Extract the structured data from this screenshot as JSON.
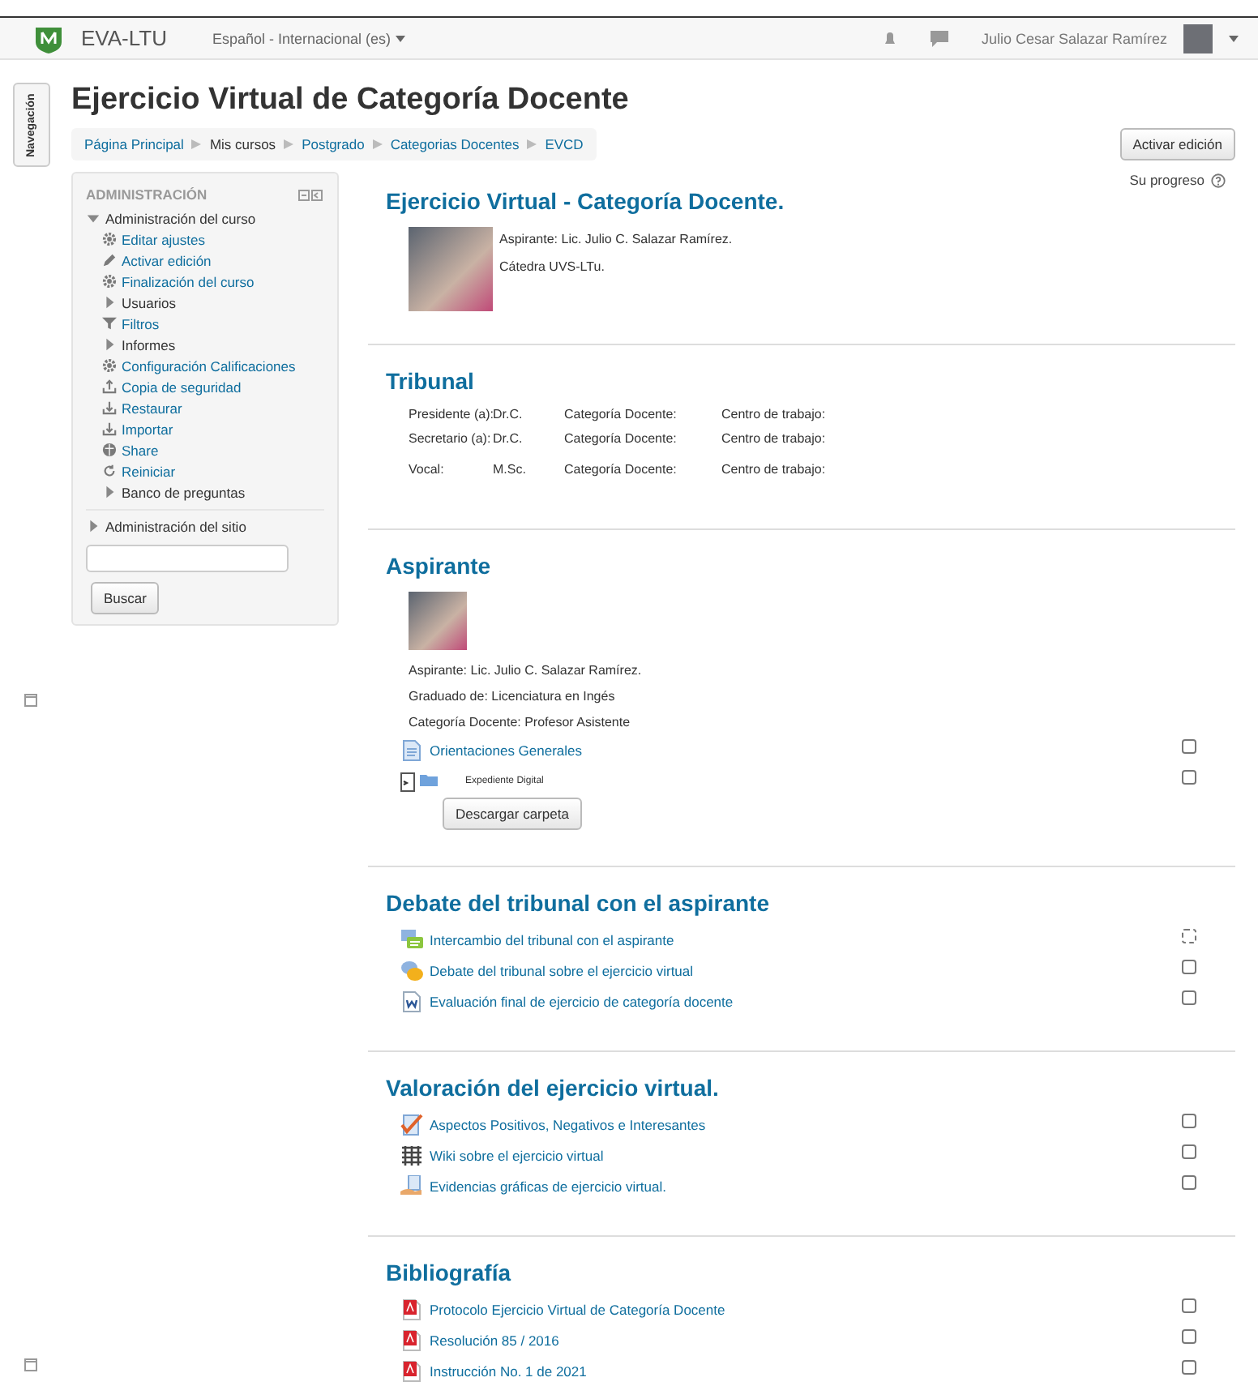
{
  "header": {
    "site_name": "EVA-LTU",
    "language": "Español - Internacional (es)",
    "user_name": "Julio Cesar Salazar Ramírez"
  },
  "nav_tab": "Navegación",
  "page_title": "Ejercicio Virtual de Categoría Docente",
  "breadcrumb": [
    {
      "label": "Página Principal",
      "link": true
    },
    {
      "label": "Mis cursos",
      "link": false
    },
    {
      "label": "Postgrado",
      "link": true
    },
    {
      "label": "Categorias Docentes",
      "link": true
    },
    {
      "label": "EVCD",
      "link": true
    }
  ],
  "edit_button": "Activar edición",
  "admin_block": {
    "title": "ADMINISTRACIÓN",
    "search_button": "Buscar",
    "items": [
      {
        "label": "Administración del curso",
        "kind": "branch",
        "expanded": true,
        "children": [
          {
            "label": "Editar ajustes",
            "kind": "gear"
          },
          {
            "label": "Activar edición",
            "kind": "pencil"
          },
          {
            "label": "Finalización del curso",
            "kind": "gear"
          },
          {
            "label": "Usuarios",
            "kind": "branch",
            "expanded": false
          },
          {
            "label": "Filtros",
            "kind": "filter"
          },
          {
            "label": "Informes",
            "kind": "branch",
            "expanded": false
          },
          {
            "label": "Configuración Calificaciones",
            "kind": "gear"
          },
          {
            "label": "Copia de seguridad",
            "kind": "upload"
          },
          {
            "label": "Restaurar",
            "kind": "download"
          },
          {
            "label": "Importar",
            "kind": "download"
          },
          {
            "label": "Share",
            "kind": "globe"
          },
          {
            "label": "Reiniciar",
            "kind": "reset"
          },
          {
            "label": "Banco de preguntas",
            "kind": "branch",
            "expanded": false
          }
        ]
      },
      {
        "label": "Administración del sitio",
        "kind": "branch",
        "expanded": false
      }
    ]
  },
  "progress_label": "Su progreso",
  "sections": [
    {
      "title": "Ejercicio Virtual - Categoría Docente.",
      "content": [
        {
          "kind": "profile",
          "lines": [
            "Aspirante: Lic. Julio C. Salazar Ramírez.",
            "Cátedra UVS-LTu."
          ]
        }
      ]
    },
    {
      "title": "Tribunal",
      "content": [
        {
          "kind": "table",
          "rows": [
            [
              "Presidente (a):",
              "Dr.C.",
              "Categoría Docente:",
              "Centro de trabajo:"
            ],
            [
              "Secretario (a):",
              "Dr.C.",
              "Categoría Docente:",
              "Centro de trabajo:"
            ],
            [
              "Vocal:",
              "M.Sc.",
              "Categoría Docente:",
              "Centro de trabajo:"
            ]
          ]
        }
      ]
    },
    {
      "title": "Aspirante",
      "content": [
        {
          "kind": "photo"
        },
        {
          "kind": "text",
          "lines": [
            "Aspirante: Lic. Julio C. Salazar Ramírez.",
            "Graduado de: Licenciatura en Ingés",
            "Categoría Docente: Profesor Asistente"
          ]
        },
        {
          "kind": "page",
          "label": "Orientaciones Generales",
          "disabled": false,
          "checked": false
        },
        {
          "kind": "folder",
          "label": "Expediente Digital",
          "button": "Descargar carpeta",
          "disabled": false,
          "checked": false
        }
      ]
    },
    {
      "title": "Debate del tribunal con el aspirante",
      "content": [
        {
          "kind": "chat",
          "label": "Intercambio del tribunal con el aspirante",
          "disabled": true,
          "checked": false
        },
        {
          "kind": "forum",
          "label": "Debate del tribunal sobre el ejercicio virtual",
          "disabled": false,
          "checked": false
        },
        {
          "kind": "word",
          "label": "Evaluación final de ejercicio de categoría docente",
          "disabled": false,
          "checked": false
        }
      ]
    },
    {
      "title": "Valoración del ejercicio virtual.",
      "content": [
        {
          "kind": "check",
          "label": "Aspectos Positivos, Negativos e Interesantes",
          "disabled": false,
          "checked": false
        },
        {
          "kind": "wiki",
          "label": "Wiki sobre el ejercicio virtual",
          "disabled": false,
          "checked": false
        },
        {
          "kind": "assign",
          "label": "Evidencias gráficas de ejercicio virtual.",
          "disabled": false,
          "checked": false
        }
      ]
    },
    {
      "title": "Bibliografía",
      "content": [
        {
          "kind": "pdf",
          "label": "Protocolo Ejercicio Virtual de Categoría Docente",
          "disabled": false,
          "checked": false
        },
        {
          "kind": "pdf",
          "label": "Resolución 85 / 2016",
          "disabled": false,
          "checked": false
        },
        {
          "kind": "pdf",
          "label": "Instrucción No. 1 de 2021",
          "disabled": false,
          "checked": false
        }
      ]
    }
  ]
}
